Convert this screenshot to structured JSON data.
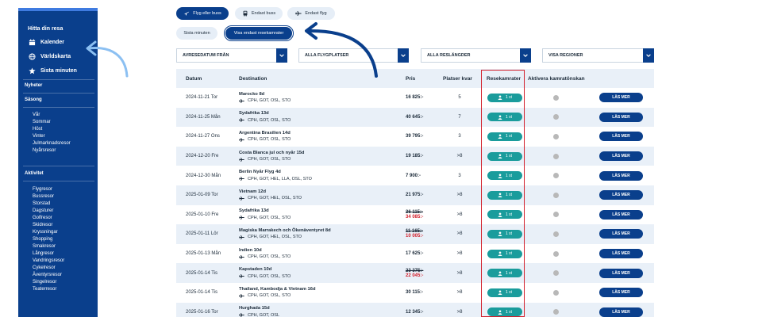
{
  "sidebar": {
    "title": "Hitta din resa",
    "nav": [
      {
        "label": "Kalender",
        "icon": "calendar-icon"
      },
      {
        "label": "Världskarta",
        "icon": "globe-icon"
      },
      {
        "label": "Sista minuten",
        "icon": "star-icon"
      }
    ],
    "sections": {
      "news": "Nyheter",
      "season": "Säsong",
      "activity": "Aktivitet"
    },
    "season_items": [
      "Vår",
      "Sommar",
      "Höst",
      "Vinter",
      "Julmarknadsresor",
      "Nyårsresor"
    ],
    "activity_items": [
      "Flygresor",
      "Bussresor",
      "Storstad",
      "Dagsturer",
      "Golfresor",
      "Skidresor",
      "Kryssningar",
      "Shopping",
      "Smakresor",
      "Långresor",
      "Vandringsresor",
      "Cykelresor",
      "Äventyrsresor",
      "Singelresor",
      "Teaterresor"
    ]
  },
  "filters": {
    "flight_or_bus": "Flyg eller buss",
    "bus_only": "Endast buss",
    "flight_only": "Endast flyg",
    "last_minute": "Sista minuten",
    "show_travelmates_only": "Visa endast resekamrater"
  },
  "dropdowns": {
    "date": "AVRESEDATUM FRÅN",
    "airports": "ALLA FLYGPLATSER",
    "lengths": "ALLA RESLÄNGDER",
    "regions": "VISA REGIONER"
  },
  "table": {
    "headers": {
      "date": "Datum",
      "destination": "Destination",
      "price": "Pris",
      "seats": "Platser kvar",
      "mates": "Resekamrater",
      "activate": "Aktivera kamratönskan"
    },
    "mates_label": "1 st",
    "more_label": "LÄS MER",
    "rows": [
      {
        "date": "2024-11-21 Tor",
        "name": "Marocko 8d",
        "route": "CPH, GOT, OSL, STO",
        "price": "16 825:-",
        "old": "",
        "seats": "5"
      },
      {
        "date": "2024-11-25 Mån",
        "name": "Sydafrika 13d",
        "route": "CPH, GOT, OSL, STO",
        "price": "40 645:-",
        "old": "",
        "seats": "7"
      },
      {
        "date": "2024-11-27 Ons",
        "name": "Argentina Brasilien 14d",
        "route": "CPH, GOT, OSL, STO",
        "price": "39 795:-",
        "old": "",
        "seats": "3"
      },
      {
        "date": "2024-12-20 Fre",
        "name": "Costa Blanca jul och nyår 15d",
        "route": "CPH, GOT, OSL, STO",
        "price": "19 185:-",
        "old": "",
        "seats": ">8"
      },
      {
        "date": "2024-12-30 Mån",
        "name": "Berlin Nyår Flyg 4d",
        "route": "CPH, GOT, HEL, LLA, OSL, STO",
        "price": "7 900:-",
        "old": "",
        "seats": "3"
      },
      {
        "date": "2025-01-09 Tor",
        "name": "Vietnam 12d",
        "route": "CPH, GOT, HEL, OSL, STO",
        "price": "21 975:-",
        "old": "",
        "seats": ">8"
      },
      {
        "date": "2025-01-10 Fre",
        "name": "Sydafrika 13d",
        "route": "CPH, GOT, OSL, STO",
        "price": "34 085:-",
        "old": "36 115:-",
        "seats": ">8"
      },
      {
        "date": "2025-01-11 Lör",
        "name": "Magiska Marrakech och Ökenäventyret 8d",
        "route": "CPH, GOT, HEL, OSL, STO",
        "price": "10 005:-",
        "old": "11 165:-",
        "seats": ">8"
      },
      {
        "date": "2025-01-13 Mån",
        "name": "Indien 10d",
        "route": "CPH, GOT, OSL, STO",
        "price": "17 625:-",
        "old": "",
        "seats": ">8"
      },
      {
        "date": "2025-01-14 Tis",
        "name": "Kapstaden 10d",
        "route": "CPH, GOT, OSL, STO",
        "price": "22 045:-",
        "old": "23 375:-",
        "seats": ">8"
      },
      {
        "date": "2025-01-14 Tis",
        "name": "Thailand, Kambodja & Vietnam 16d",
        "route": "CPH, GOT, OSL, STO",
        "price": "30 115:-",
        "old": "",
        "seats": ">8"
      },
      {
        "date": "2025-01-16 Tor",
        "name": "Hurghada 15d",
        "route": "CPH, GOT, OSL",
        "price": "12 345:-",
        "old": "",
        "seats": ">8"
      }
    ]
  },
  "colors": {
    "brand": "#0a3f8c",
    "teal": "#1a9c9c",
    "highlight": "#d21f2b",
    "row_alt": "#e9f0f8"
  }
}
